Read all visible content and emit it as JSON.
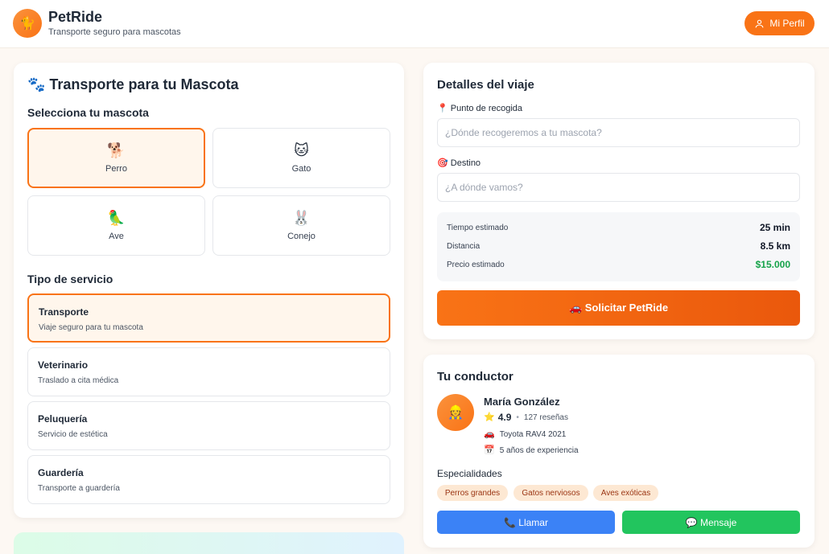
{
  "header": {
    "logo_glyph": "🐈",
    "app_name": "PetRide",
    "tagline": "Transporte seguro para mascotas",
    "profile_label": "Mi Perfil"
  },
  "booking": {
    "title": "🐾 Transporte para tu Mascota",
    "pet_section_title": "Selecciona tu mascota",
    "pets": [
      {
        "emoji": "🐕",
        "label": "Perro",
        "selected": true
      },
      {
        "emoji": "🐱",
        "label": "Gato",
        "selected": false
      },
      {
        "emoji": "🦜",
        "label": "Ave",
        "selected": false
      },
      {
        "emoji": "🐰",
        "label": "Conejo",
        "selected": false
      }
    ],
    "service_section_title": "Tipo de servicio",
    "services": [
      {
        "name": "Transporte",
        "desc": "Viaje seguro para tu mascota",
        "selected": true
      },
      {
        "name": "Veterinario",
        "desc": "Traslado a cita médica",
        "selected": false
      },
      {
        "name": "Peluquería",
        "desc": "Servicio de estética",
        "selected": false
      },
      {
        "name": "Guardería",
        "desc": "Transporte a guardería",
        "selected": false
      }
    ]
  },
  "trip": {
    "title": "Detalles del viaje",
    "pickup_label": "📍 Punto de recogida",
    "pickup_placeholder": "¿Dónde recogeremos a tu mascota?",
    "pickup_value": "",
    "destination_label": "🎯 Destino",
    "destination_placeholder": "¿A dónde vamos?",
    "destination_value": "",
    "estimates": [
      {
        "label": "Tiempo estimado",
        "value": "25 min"
      },
      {
        "label": "Distancia",
        "value": "8.5 km"
      },
      {
        "label": "Precio estimado",
        "value": "$15.000"
      }
    ],
    "request_label": "🚗 Solicitar PetRide"
  },
  "driver": {
    "title": "Tu conductor",
    "avatar_glyph": "👷",
    "name": "María González",
    "rating_star": "⭐",
    "rating": "4.9",
    "reviews": "127 reseñas",
    "car_icon": "🚗",
    "car": "Toyota RAV4 2021",
    "experience_icon": "📅",
    "experience": "5 años de experiencia",
    "specialties_title": "Especialidades",
    "specialties": [
      "Perros grandes",
      "Gatos nerviosos",
      "Aves exóticas"
    ],
    "call_label": "📞 Llamar",
    "message_label": "💬 Mensaje"
  },
  "colors": {
    "accent": "#f97316",
    "price": "#16a34a",
    "call": "#3b82f6",
    "message": "#22c55e"
  }
}
